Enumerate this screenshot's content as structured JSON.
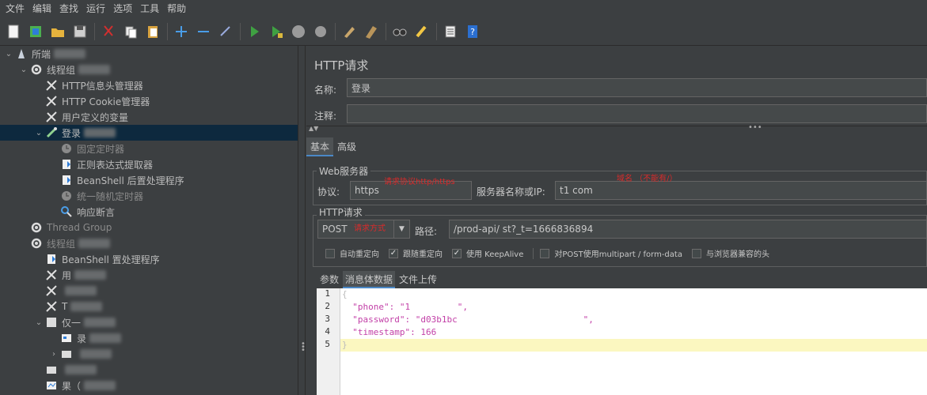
{
  "menu": [
    "文件",
    "编辑",
    "查找",
    "运行",
    "选项",
    "工具",
    "帮助"
  ],
  "toolbar": {
    "buttons": [
      "new-icon",
      "templates-icon",
      "open-icon",
      "save-icon",
      "cut-icon",
      "copy-icon",
      "paste-icon",
      "add-icon",
      "remove-icon",
      "toggle-icon",
      "start-icon",
      "start-no-pause-icon",
      "stop-icon",
      "shutdown-icon",
      "clear-icon",
      "clear-all-icon",
      "search-icon",
      "reset-search-icon",
      "function-helper-icon",
      "help-icon"
    ]
  },
  "tree": {
    "nodes": [
      {
        "label": "所端",
        "arrow": "v",
        "indent": 0,
        "icon": "testplan-icon",
        "selected": false,
        "disabled": false
      },
      {
        "label": "线程组",
        "arrow": "v",
        "indent": 1,
        "icon": "gear-icon",
        "selected": false,
        "disabled": false
      },
      {
        "label": "HTTP信息头管理器",
        "arrow": "",
        "indent": 2,
        "icon": "wrench-icon",
        "selected": false,
        "disabled": false
      },
      {
        "label": "HTTP Cookie管理器",
        "arrow": "",
        "indent": 2,
        "icon": "wrench-icon",
        "selected": false,
        "disabled": false
      },
      {
        "label": "用户定义的变量",
        "arrow": "",
        "indent": 2,
        "icon": "wrench-icon",
        "selected": false,
        "disabled": false
      },
      {
        "label": "登录",
        "arrow": "v",
        "indent": 2,
        "icon": "pipette-icon",
        "selected": true,
        "disabled": false
      },
      {
        "label": "固定定时器",
        "arrow": "",
        "indent": 3,
        "icon": "timer-icon",
        "selected": false,
        "disabled": true
      },
      {
        "label": "正则表达式提取器",
        "arrow": "",
        "indent": 3,
        "icon": "extractor-icon",
        "selected": false,
        "disabled": false
      },
      {
        "label": "BeanShell 后置处理程序",
        "arrow": "",
        "indent": 3,
        "icon": "extractor-icon",
        "selected": false,
        "disabled": false
      },
      {
        "label": "统一随机定时器",
        "arrow": "",
        "indent": 3,
        "icon": "timer-icon",
        "selected": false,
        "disabled": true
      },
      {
        "label": "响应断言",
        "arrow": "",
        "indent": 3,
        "icon": "magnifier-icon",
        "selected": false,
        "disabled": false
      },
      {
        "label": "Thread Group",
        "arrow": "",
        "indent": 1,
        "icon": "gear-icon",
        "selected": false,
        "disabled": true
      },
      {
        "label": "线程组",
        "arrow": "",
        "indent": 1,
        "icon": "gear-icon",
        "selected": false,
        "disabled": true
      },
      {
        "label": "BeanShell 置处理程序",
        "arrow": "",
        "indent": 2,
        "icon": "extractor-icon",
        "selected": false,
        "disabled": false
      },
      {
        "label": "用",
        "arrow": "",
        "indent": 2,
        "icon": "wrench-icon",
        "selected": false,
        "disabled": false
      },
      {
        "label": "",
        "arrow": "",
        "indent": 2,
        "icon": "wrench-icon",
        "selected": false,
        "disabled": false
      },
      {
        "label": "T",
        "arrow": "",
        "indent": 2,
        "icon": "wrench-icon",
        "selected": false,
        "disabled": false
      },
      {
        "label": "仅一",
        "arrow": "v",
        "indent": 2,
        "icon": "controller-icon",
        "selected": false,
        "disabled": false
      },
      {
        "label": "录",
        "arrow": "",
        "indent": 3,
        "icon": "recorder-icon",
        "selected": false,
        "disabled": false
      },
      {
        "label": "",
        "arrow": ">",
        "indent": 3,
        "icon": "folder-icon",
        "selected": false,
        "disabled": false
      },
      {
        "label": "",
        "arrow": "",
        "indent": 2,
        "icon": "folder-icon",
        "selected": false,
        "disabled": false
      },
      {
        "label": "果（",
        "arrow": "",
        "indent": 2,
        "icon": "listener-icon",
        "selected": false,
        "disabled": false
      }
    ]
  },
  "panel": {
    "title": "HTTP请求",
    "name_label": "名称:",
    "name_value": "登录",
    "comment_label": "注释:",
    "comment_value": "",
    "tabs": [
      "基本",
      "高级"
    ],
    "web_server_title": "Web服务器",
    "protocol_label": "协议:",
    "protocol_value": "https",
    "protocol_note": "请求协议http/https",
    "server_label": "服务器名称或IP:",
    "server_value": "t1        com",
    "server_note": "域名 （不能有/）",
    "http_request_title": "HTTP请求",
    "method_value": "POST",
    "method_note": "请求方式",
    "path_label": "路径:",
    "path_value": "/prod-api/                    st?_t=1666836894",
    "checkboxes": [
      {
        "label": "自动重定向",
        "checked": false
      },
      {
        "label": "跟随重定向",
        "checked": true
      },
      {
        "label": "使用 KeepAlive",
        "checked": true
      },
      {
        "label": "对POST使用multipart / form-data",
        "checked": false
      },
      {
        "label": "与浏览器兼容的头",
        "checked": false
      }
    ],
    "subtabs": [
      "参数",
      "消息体数据",
      "文件上传"
    ],
    "body_lines": [
      {
        "num": "1",
        "text": "{"
      },
      {
        "num": "2",
        "text": "  \"phone\": \"1         \","
      },
      {
        "num": "3",
        "text": "  \"password\": \"d03b1bc                        \","
      },
      {
        "num": "4",
        "text": "  \"timestamp\": 166"
      },
      {
        "num": "5",
        "text": "}"
      }
    ]
  }
}
